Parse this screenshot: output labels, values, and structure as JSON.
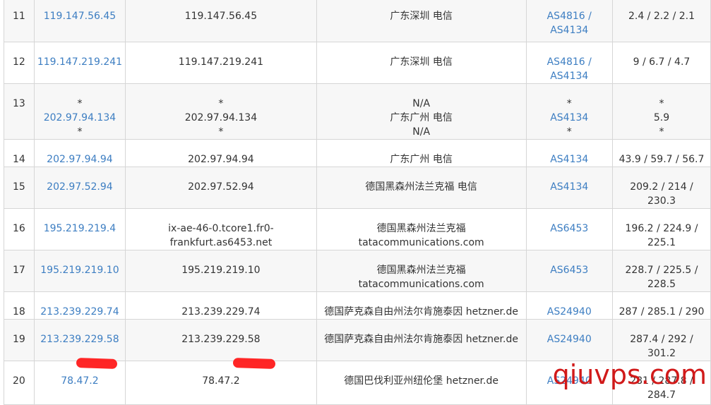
{
  "watermark": "qiuvps.com",
  "rows": [
    {
      "num": "11",
      "ip": [
        "119.147.56.45"
      ],
      "host": [
        "119.147.56.45"
      ],
      "loc": [
        "广东深圳 电信"
      ],
      "as": [
        "AS4816 /",
        "AS4134"
      ],
      "lat": [
        "2.4 / 2.2 / 2.1"
      ]
    },
    {
      "num": "12",
      "ip": [
        "119.147.219.241"
      ],
      "host": [
        "119.147.219.241"
      ],
      "loc": [
        "广东深圳 电信"
      ],
      "as": [
        "AS4816 /",
        "AS4134"
      ],
      "lat": [
        "9 / 6.7 / 4.7"
      ]
    },
    {
      "num": "13",
      "ip": [
        "*",
        "202.97.94.134",
        "*"
      ],
      "host": [
        "*",
        "202.97.94.134",
        "*"
      ],
      "loc": [
        "N/A",
        "广东广州 电信",
        "N/A"
      ],
      "as": [
        "*",
        "AS4134",
        "*"
      ],
      "lat": [
        "*",
        "5.9",
        "*"
      ]
    },
    {
      "num": "14",
      "ip": [
        "202.97.94.94"
      ],
      "host": [
        "202.97.94.94"
      ],
      "loc": [
        "广东广州 电信"
      ],
      "as": [
        "AS4134"
      ],
      "lat": [
        "43.9 / 59.7 / 56.7"
      ]
    },
    {
      "num": "15",
      "ip": [
        "202.97.52.94"
      ],
      "host": [
        "202.97.52.94"
      ],
      "loc": [
        "德国黑森州法兰克福 电信"
      ],
      "as": [
        "AS4134"
      ],
      "lat": [
        "209.2 / 214 /",
        "230.3"
      ]
    },
    {
      "num": "16",
      "ip": [
        "195.219.219.4"
      ],
      "host": [
        "ix-ae-46-0.tcore1.fr0-",
        "frankfurt.as6453.net"
      ],
      "loc": [
        "德国黑森州法兰克福",
        "tatacommunications.com"
      ],
      "as": [
        "AS6453"
      ],
      "lat": [
        "196.2 / 224.9 /",
        "225.1"
      ]
    },
    {
      "num": "17",
      "ip": [
        "195.219.219.10"
      ],
      "host": [
        "195.219.219.10"
      ],
      "loc": [
        "德国黑森州法兰克福",
        "tatacommunications.com"
      ],
      "as": [
        "AS6453"
      ],
      "lat": [
        "228.7 / 225.5 /",
        "228.5"
      ]
    },
    {
      "num": "18",
      "ip": [
        "213.239.229.74"
      ],
      "host": [
        "213.239.229.74"
      ],
      "loc": [
        "德国萨克森自由州法尔肯施泰因 hetzner.de"
      ],
      "as": [
        "AS24940"
      ],
      "lat": [
        "287 / 285.1 / 290"
      ]
    },
    {
      "num": "19",
      "ip": [
        "213.239.229.58"
      ],
      "host": [
        "213.239.229.58"
      ],
      "loc": [
        "德国萨克森自由州法尔肯施泰因 hetzner.de"
      ],
      "as": [
        "AS24940"
      ],
      "lat": [
        "287.4 / 292 /",
        "301.2"
      ]
    },
    {
      "num": "20",
      "ip": [
        "78.47.2"
      ],
      "host": [
        "78.47.2"
      ],
      "loc": [
        "德国巴伐利亚州纽伦堡 hetzner.de"
      ],
      "as": [
        "AS24940"
      ],
      "lat": [
        "281 / 287.8 /",
        "284.7"
      ]
    }
  ]
}
